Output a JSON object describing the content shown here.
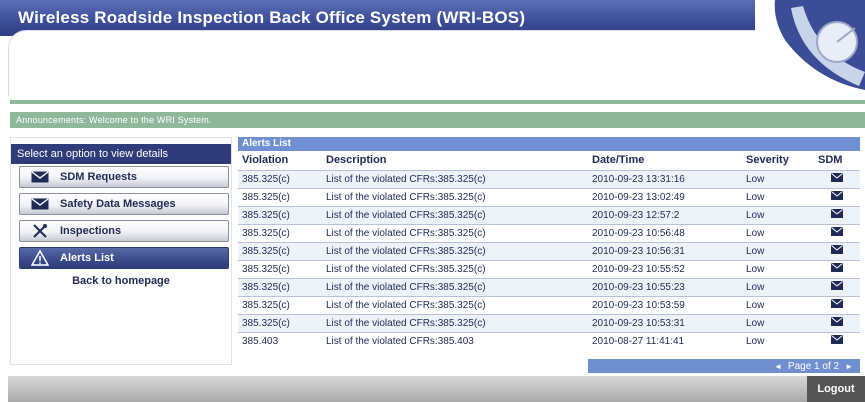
{
  "header": {
    "title": "Wireless Roadside Inspection Back Office System (WRI-BOS)"
  },
  "announcement": "Announcements: Welcome to the WRI System.",
  "menu": {
    "prompt": "Select an option to view details",
    "items": [
      {
        "label": "SDM Requests",
        "icon": "envelope-icon"
      },
      {
        "label": "Safety Data Messages",
        "icon": "envelope-icon"
      },
      {
        "label": "Inspections",
        "icon": "tools-icon"
      },
      {
        "label": "Alerts List",
        "icon": "warning-icon",
        "active": true
      }
    ],
    "back_link": "Back to homepage"
  },
  "alerts": {
    "title": "Alerts List",
    "columns": [
      "Violation",
      "Description",
      "Date/Time",
      "Severity",
      "SDM"
    ],
    "rows": [
      {
        "violation": "385.325(c)",
        "description": "List of the violated CFRs:385.325(c)",
        "datetime": "2010-09-23 13:31:16",
        "severity": "Low"
      },
      {
        "violation": "385.325(c)",
        "description": "List of the violated CFRs:385.325(c)",
        "datetime": "2010-09-23 13:02:49",
        "severity": "Low"
      },
      {
        "violation": "385.325(c)",
        "description": "List of the violated CFRs:385.325(c)",
        "datetime": "2010-09-23 12:57:2",
        "severity": "Low"
      },
      {
        "violation": "385.325(c)",
        "description": "List of the violated CFRs:385.325(c)",
        "datetime": "2010-09-23 10:56:48",
        "severity": "Low"
      },
      {
        "violation": "385.325(c)",
        "description": "List of the violated CFRs:385.325(c)",
        "datetime": "2010-09-23 10:56:31",
        "severity": "Low"
      },
      {
        "violation": "385.325(c)",
        "description": "List of the violated CFRs:385.325(c)",
        "datetime": "2010-09-23 10:55:52",
        "severity": "Low"
      },
      {
        "violation": "385.325(c)",
        "description": "List of the violated CFRs:385.325(c)",
        "datetime": "2010-09-23 10:55:23",
        "severity": "Low"
      },
      {
        "violation": "385.325(c)",
        "description": "List of the violated CFRs:385.325(c)",
        "datetime": "2010-09-23 10:53:59",
        "severity": "Low"
      },
      {
        "violation": "385.325(c)",
        "description": "List of the violated CFRs:385.325(c)",
        "datetime": "2010-09-23 10:53:31",
        "severity": "Low"
      },
      {
        "violation": "385.403",
        "description": "List of the violated CFRs:385.403",
        "datetime": "2010-08-27 11:41:41",
        "severity": "Low"
      }
    ],
    "pager": {
      "label": "Page 1 of 2",
      "prev": "◄",
      "next": "►"
    }
  },
  "footer": {
    "logout_label": "Logout"
  },
  "colors": {
    "header": "#3b4d97",
    "green": "#8fb89b",
    "table_head": "#6f8fd1",
    "menu_dark": "#2e3c7a"
  }
}
